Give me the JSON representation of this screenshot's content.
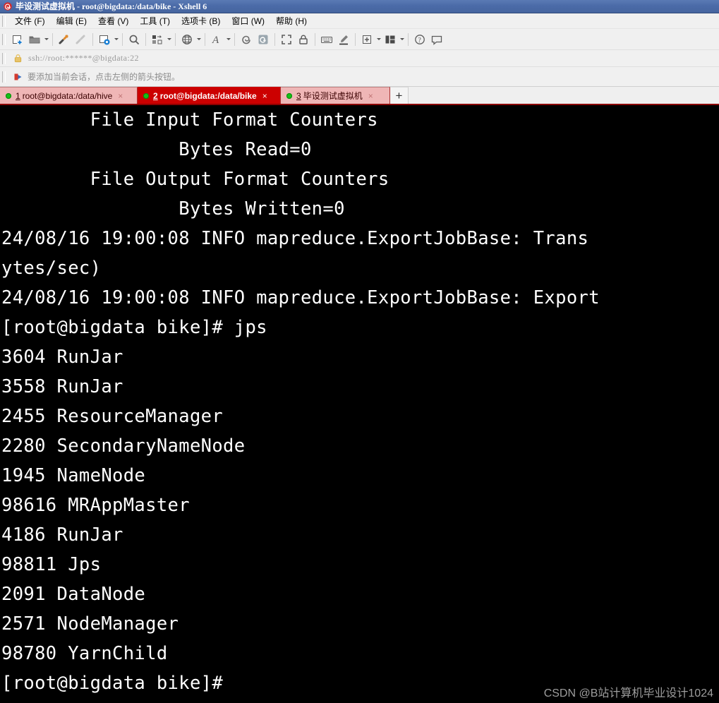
{
  "window": {
    "title": "毕设测试虚拟机 - root@bigdata:/data/bike - Xshell 6",
    "app_icon": "xshell-spiral-icon"
  },
  "menubar": {
    "items": [
      {
        "label": "文件 (F)",
        "name": "menu-file"
      },
      {
        "label": "编辑 (E)",
        "name": "menu-edit"
      },
      {
        "label": "查看 (V)",
        "name": "menu-view"
      },
      {
        "label": "工具 (T)",
        "name": "menu-tools"
      },
      {
        "label": "选项卡 (B)",
        "name": "menu-tabs"
      },
      {
        "label": "窗口 (W)",
        "name": "menu-window"
      },
      {
        "label": "帮助 (H)",
        "name": "menu-help"
      }
    ]
  },
  "toolbar": {
    "icons": [
      "new-session-icon",
      "open-folder-icon",
      "connect-icon",
      "disconnect-icon",
      "session-properties-icon",
      "find-icon",
      "file-transfer-icon",
      "globe-icon",
      "font-icon",
      "xshell-icon",
      "xftp-icon",
      "fullscreen-icon",
      "lock-icon",
      "keyboard-icon",
      "highlight-icon",
      "add-layout-icon",
      "layout-icon",
      "help-icon",
      "feedback-icon"
    ]
  },
  "address": {
    "value": "ssh://root:******@bigdata:22",
    "placeholder": "ssh://",
    "icon": "lock-icon"
  },
  "notice": {
    "icon": "red-arrow-icon",
    "text": "要添加当前会话，点击左侧的箭头按钮。"
  },
  "tabs": {
    "items": [
      {
        "num": "1",
        "label": "root@bigdata:/data/hive",
        "active": false,
        "status": "connected"
      },
      {
        "num": "2",
        "label": "root@bigdata:/data/bike",
        "active": true,
        "status": "connected"
      },
      {
        "num": "3",
        "label": "毕设测试虚拟机",
        "active": false,
        "status": "connected"
      }
    ],
    "add_label": "+"
  },
  "terminal": {
    "lines": [
      "        File Input Format Counters",
      "                Bytes Read=0",
      "        File Output Format Counters",
      "                Bytes Written=0",
      "24/08/16 19:00:08 INFO mapreduce.ExportJobBase: Trans",
      "ytes/sec)",
      "24/08/16 19:00:08 INFO mapreduce.ExportJobBase: Export",
      "[root@bigdata bike]# jps",
      "3604 RunJar",
      "3558 RunJar",
      "2455 ResourceManager",
      "2280 SecondaryNameNode",
      "1945 NameNode",
      "98616 MRAppMaster",
      "4186 RunJar",
      "98811 Jps",
      "2091 DataNode",
      "2571 NodeManager",
      "98780 YarnChild",
      "[root@bigdata bike]#"
    ]
  },
  "watermark": {
    "text": "CSDN @B站计算机毕业设计1024"
  },
  "colors": {
    "titlebar": "#4b6ba8",
    "tab_active": "#cc0000",
    "tab_inactive": "#efb6b6",
    "terminal_bg": "#000000",
    "terminal_fg": "#ffffff",
    "status_dot": "#17c017"
  }
}
